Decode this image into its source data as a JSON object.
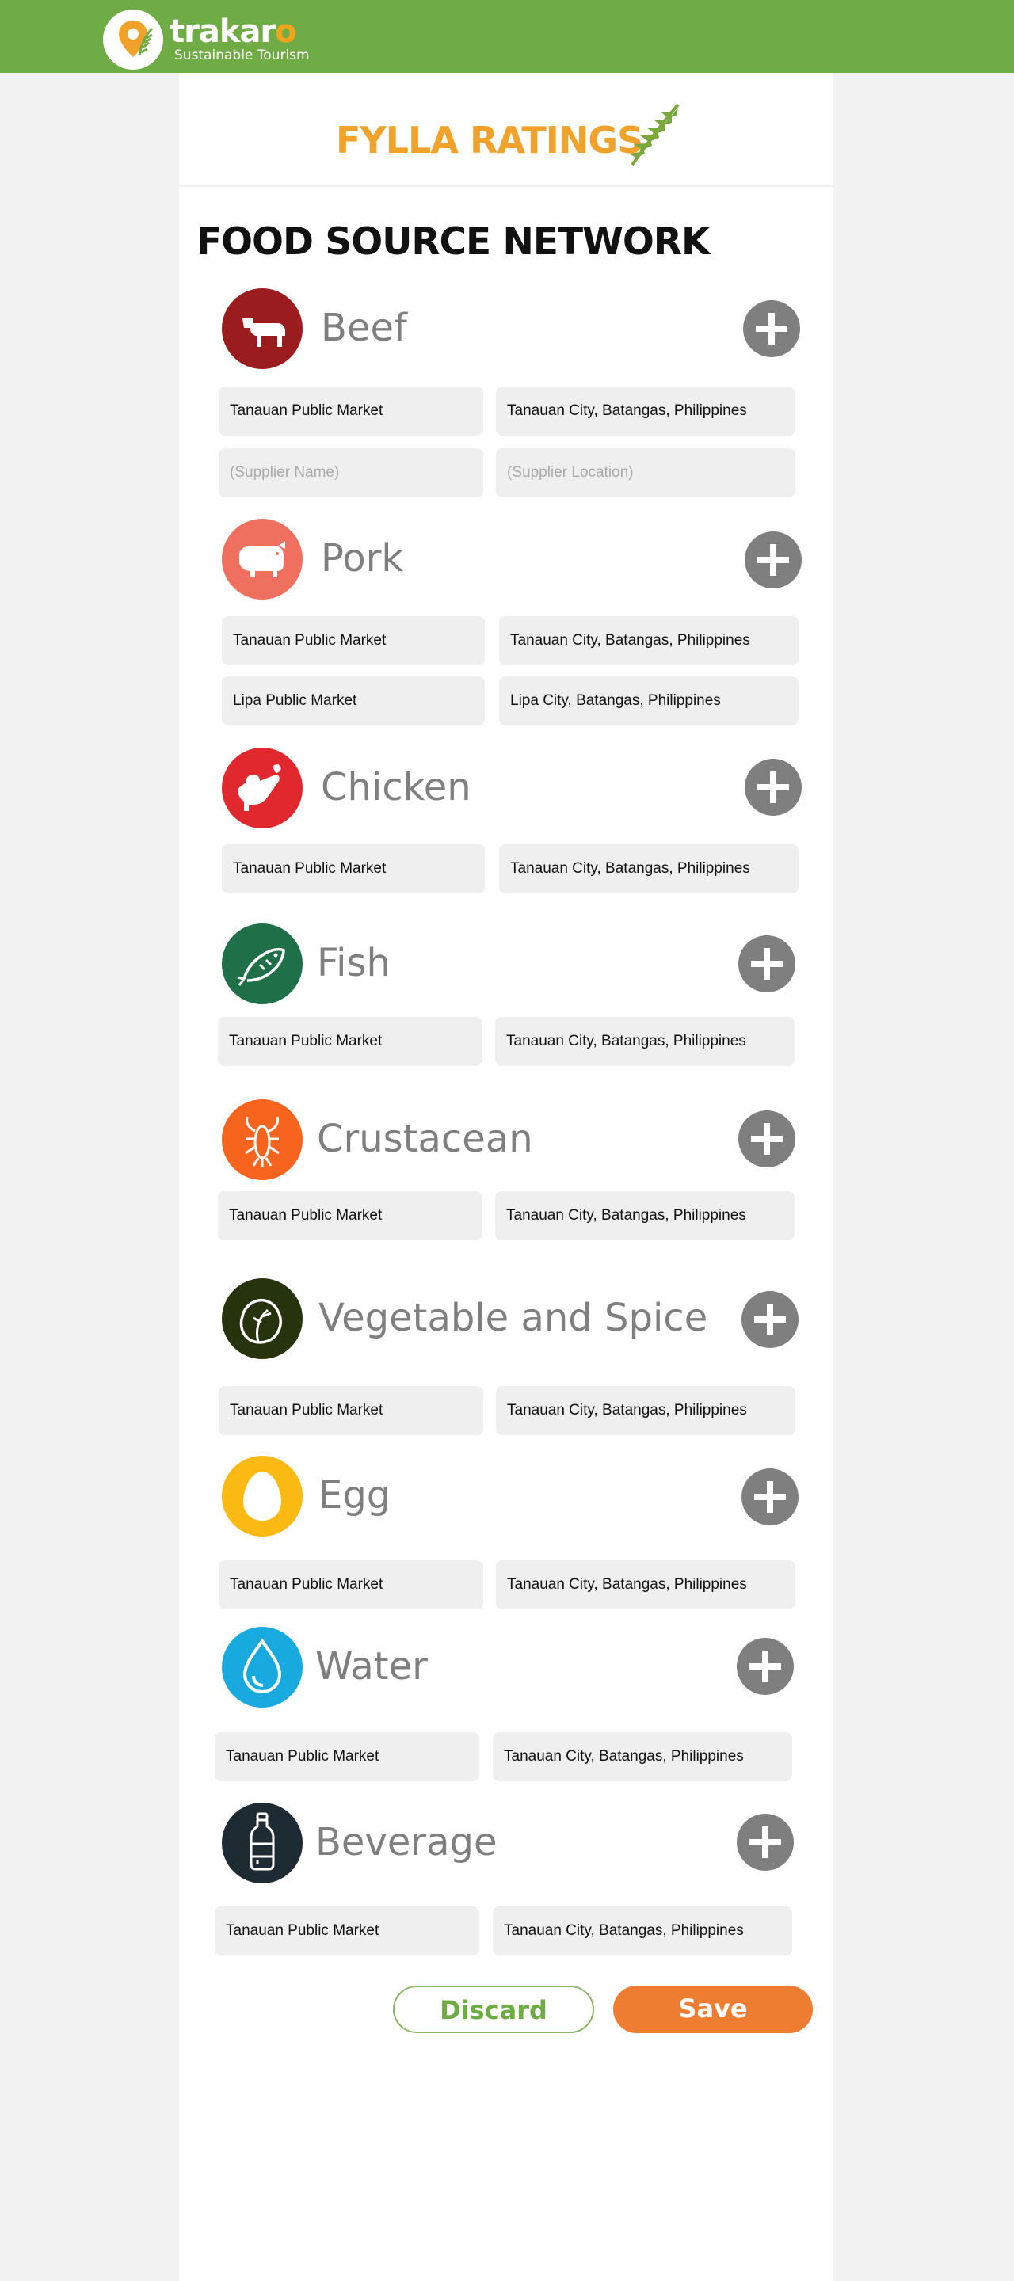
{
  "header": {
    "brand_name_main": "trakar",
    "brand_name_accent": "o",
    "tagline": "Sustainable Tourism",
    "brand_color": "#6fac46"
  },
  "banner": {
    "title": "FYLLA RATINGS",
    "title_color": "#f0a22b"
  },
  "page": {
    "heading": "FOOD SOURCE NETWORK"
  },
  "categories": [
    {
      "name": "Beef",
      "icon": "cow-icon",
      "color": "#9a1c1f",
      "rows": [
        {
          "supplier": "Tanauan Public Market",
          "location": "Tanauan City, Batangas, Philippines"
        },
        {
          "supplier_placeholder": "(Supplier Name)",
          "location_placeholder": "(Supplier Location)"
        }
      ]
    },
    {
      "name": "Pork",
      "icon": "pig-icon",
      "color": "#f07060",
      "rows": [
        {
          "supplier": "Tanauan Public Market",
          "location": "Tanauan City, Batangas, Philippines"
        },
        {
          "supplier": "Lipa Public Market",
          "location": "Lipa City, Batangas, Philippines"
        }
      ]
    },
    {
      "name": "Chicken",
      "icon": "chicken-icon",
      "color": "#e0282e",
      "rows": [
        {
          "supplier": "Tanauan Public Market",
          "location": "Tanauan City, Batangas, Philippines"
        }
      ]
    },
    {
      "name": "Fish",
      "icon": "fish-icon",
      "color": "#1f7049",
      "rows": [
        {
          "supplier": "Tanauan Public Market",
          "location": "Tanauan City, Batangas, Philippines"
        }
      ]
    },
    {
      "name": "Crustacean",
      "icon": "lobster-icon",
      "color": "#f7641e",
      "rows": [
        {
          "supplier": "Tanauan Public Market",
          "location": "Tanauan City, Batangas, Philippines"
        }
      ]
    },
    {
      "name": "Vegetable and Spice",
      "icon": "lettuce-icon",
      "color": "#27330c",
      "rows": [
        {
          "supplier": "Tanauan Public Market",
          "location": "Tanauan City, Batangas, Philippines"
        }
      ]
    },
    {
      "name": "Egg",
      "icon": "egg-icon",
      "color": "#fbb914",
      "rows": [
        {
          "supplier": "Tanauan Public Market",
          "location": "Tanauan City, Batangas, Philippines"
        }
      ]
    },
    {
      "name": "Water",
      "icon": "water-drop-icon",
      "color": "#18a9de",
      "rows": [
        {
          "supplier": "Tanauan Public Market",
          "location": "Tanauan City, Batangas, Philippines"
        }
      ]
    },
    {
      "name": "Beverage",
      "icon": "bottle-icon",
      "color": "#1f2b33",
      "rows": [
        {
          "supplier": "Tanauan Public Market",
          "location": "Tanauan City, Batangas, Philippines"
        }
      ]
    }
  ],
  "actions": {
    "discard_label": "Discard",
    "save_label": "Save",
    "save_color": "#ef7d31"
  }
}
